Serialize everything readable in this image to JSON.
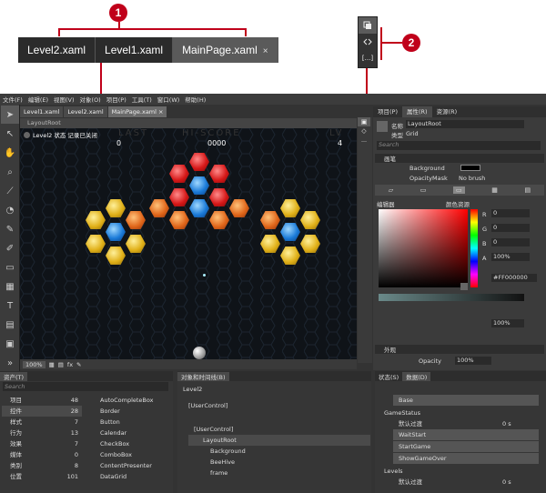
{
  "callouts": [
    "1",
    "2"
  ],
  "zoom_tabs": [
    {
      "label": "Level2.xaml"
    },
    {
      "label": "Level1.xaml"
    },
    {
      "label": "MainPage.xaml",
      "close": "×"
    }
  ],
  "zoom_toolbar": {
    "btn3": "[...]"
  },
  "menu": [
    "文件(F)",
    "编辑(E)",
    "视图(V)",
    "对象(O)",
    "项目(P)",
    "工具(T)",
    "窗口(W)",
    "帮助(H)"
  ],
  "doc_tabs": [
    {
      "label": "Level1.xaml"
    },
    {
      "label": "Level2.xaml"
    },
    {
      "label": "MainPage.xaml",
      "close": "×"
    }
  ],
  "breadcrumb": "LayoutRoot",
  "canvas": {
    "state_text": "Level2 状态 记录已关闭",
    "hud_last": "LAST",
    "hud_hiscore": "HI-SCORE",
    "hud_lv": "LV",
    "score_left": "0",
    "score_mid": "0000",
    "score_right": "4"
  },
  "canvas_status": {
    "zoom": "100%"
  },
  "props": {
    "tabs": [
      "项目(P)",
      "属性(R)",
      "资源(R)"
    ],
    "name_label": "名称",
    "name_value": "LayoutRoot",
    "type_label": "类型",
    "type_value": "Grid",
    "search_placeholder": "Search",
    "section_brush": "画笔",
    "background_label": "Background",
    "opacitymask_label": "OpacityMask",
    "opacitymask_value": "No brush",
    "editor_tab": "编辑器",
    "color_resources": "颜色资源",
    "r_label": "R",
    "r_value": "0",
    "g_label": "G",
    "g_value": "0",
    "b_label": "B",
    "b_value": "0",
    "a_label": "A",
    "a_value": "100%",
    "hex_value": "#FF000000",
    "gradient_pct": "100%",
    "section_appearance": "外观",
    "opacity_label": "Opacity",
    "opacity_value": "100%"
  },
  "assets": {
    "title": "资产(T)",
    "search_placeholder": "Search",
    "categories": [
      {
        "label": "项目",
        "count": "48"
      },
      {
        "label": "控件",
        "count": "28"
      },
      {
        "label": "样式",
        "count": "7"
      },
      {
        "label": "行为",
        "count": "13"
      },
      {
        "label": "效果",
        "count": "7"
      },
      {
        "label": "媒体",
        "count": "0"
      },
      {
        "label": "类别",
        "count": "8"
      },
      {
        "label": "位置",
        "count": "101"
      }
    ],
    "controls": [
      "AutoCompleteBox",
      "Border",
      "Button",
      "Calendar",
      "CheckBox",
      "ComboBox",
      "ContentPresenter",
      "DataGrid"
    ]
  },
  "objects": {
    "title": "对象和时间线(B)",
    "timeline": "Level2",
    "root": "[UserControl]",
    "userctrl": "[UserControl]",
    "items": [
      "LayoutRoot",
      "Background",
      "BeeHive",
      "frame"
    ]
  },
  "states": {
    "tabs": [
      "状态(S)",
      "数据(D)"
    ],
    "base": "Base",
    "groups": [
      {
        "name": "GameStatus",
        "default": "默认过渡",
        "default_value": "0 s",
        "states": [
          "WaitStart",
          "StartGame",
          "ShowGameOver"
        ]
      },
      {
        "name": "Levels",
        "default": "默认过渡",
        "default_value": "0 s",
        "states": []
      }
    ]
  },
  "colors": {
    "accent": "#c0001a",
    "panel": "#3b3b3b",
    "canvas": "#0f1318"
  }
}
